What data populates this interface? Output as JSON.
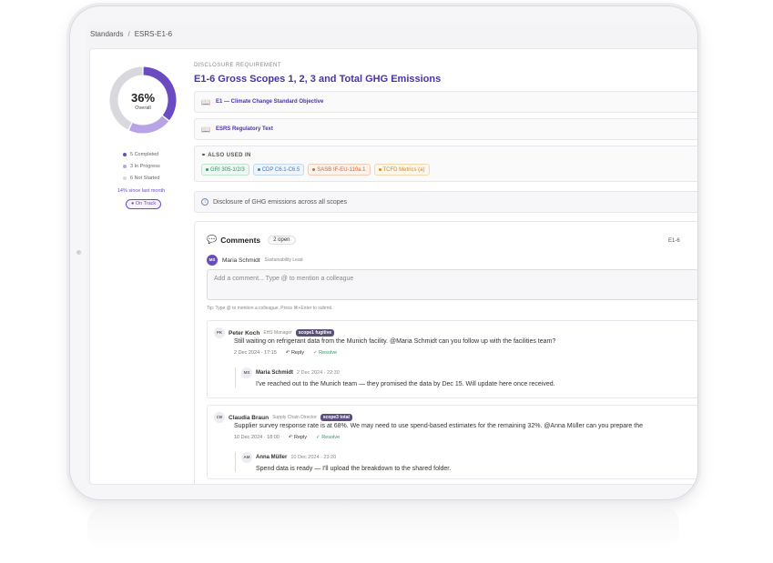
{
  "breadcrumb": {
    "root": "Standards",
    "separator": "/",
    "current": "ESRS-E1-6"
  },
  "progress": {
    "percent_label": "36%",
    "overall_label": "Overall",
    "segments": [
      {
        "label": "5 Completed",
        "value": 5,
        "color": "#6a4bc2"
      },
      {
        "label": "3 In Progress",
        "value": 3,
        "color": "#b9a3e8"
      },
      {
        "label": "6 Not Started",
        "value": 6,
        "color": "#d8d8de"
      }
    ],
    "since_label": "14% since last month",
    "status_badge": "On Track"
  },
  "disclosure": {
    "label": "DISCLOSURE REQUIREMENT",
    "title": "E1-6 Gross Scopes 1, 2, 3 and Total GHG Emissions",
    "links": [
      "E1 — Climate Change Standard Objective",
      "ESRS Regulatory Text"
    ],
    "also_used_in_label": "ALSO USED IN",
    "also_used_in": [
      {
        "label": "GRI 305-1/2/3",
        "color": "#2b9a5f",
        "bg": "#eef8f2",
        "border": "#bfe3cd"
      },
      {
        "label": "CDP C6.1-C6.5",
        "color": "#3a7bd5",
        "bg": "#eef4fc",
        "border": "#c3d8f2"
      },
      {
        "label": "SASB IF-EU-110a.1",
        "color": "#d9652b",
        "bg": "#fdf2ec",
        "border": "#f1cdb8"
      },
      {
        "label": "TCFD Metrics (a)",
        "color": "#d98a1b",
        "bg": "#fdf6ea",
        "border": "#f0d9b0"
      }
    ],
    "info_text": "Disclosure of GHG emissions across all scopes"
  },
  "comments": {
    "title": "Comments",
    "open_badge": "2 open",
    "ref": "E1-6",
    "current_user": {
      "initials": "MS",
      "name": "Maria Schmidt",
      "role": "Sustainability Lead"
    },
    "input_placeholder": "Add a comment... Type @ to mention a colleague",
    "tip": "Tip: Type @ to mention a colleague. Press ⌘+Enter to submit.",
    "threads": [
      {
        "initials": "PK",
        "name": "Peter Koch",
        "role": "EHS Manager",
        "scope": "scope1 fugitive",
        "body": "Still waiting on refrigerant data from the Munich facility. @Maria Schmidt can you follow up with the facilities team?",
        "date": "2 Dec 2024 · 17:15",
        "reply_label": "Reply",
        "resolve_label": "Resolve",
        "reply": {
          "initials": "MS",
          "name": "Maria Schmidt",
          "date": "2 Dec 2024 · 22:30",
          "body": "I've reached out to the Munich team — they promised the data by Dec 15. Will update here once received."
        }
      },
      {
        "initials": "CB",
        "name": "Claudia Braun",
        "role": "Supply Chain Director",
        "scope": "scope3 total",
        "body": "Supplier survey response rate is at 68%. We may need to use spend-based estimates for the remaining 32%. @Anna Müller can you prepare the",
        "date": "10 Dec 2024 · 18:00",
        "reply_label": "Reply",
        "resolve_label": "Resolve",
        "reply": {
          "initials": "AM",
          "name": "Anna Müller",
          "date": "10 Dec 2024 · 23:20",
          "body": "Spend data is ready — I'll upload the breakdown to the shared folder."
        }
      }
    ]
  }
}
